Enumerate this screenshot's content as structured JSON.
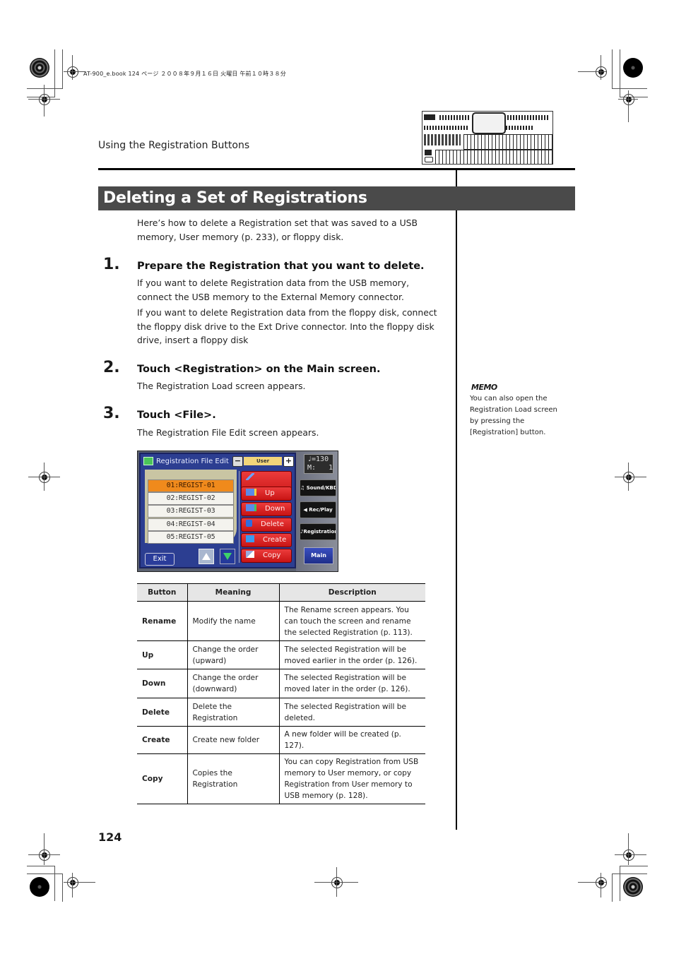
{
  "print_marks": {
    "slug": "AT-900_e.book  124 ページ  ２００８年９月１６日  火曜日  午前１０時３８分"
  },
  "header": {
    "section": "Using the Registration Buttons"
  },
  "page": {
    "title": "Deleting a Set of Registrations",
    "intro": "Here’s how to delete a Registration set that was saved to a USB memory, User memory (p. 233), or floppy disk.",
    "page_number": "124"
  },
  "steps": [
    {
      "number": "1.",
      "title": "Prepare the Registration that you want to delete.",
      "paragraphs": [
        "If you want to delete Registration data from the USB memory, connect the USB memory to the External Memory connector.",
        "If you want to delete Registration data from the floppy disk, connect the floppy disk drive to the Ext Drive connector. Into the floppy disk drive, insert a floppy disk"
      ]
    },
    {
      "number": "2.",
      "title": "Touch <Registration> on the Main screen.",
      "paragraphs": [
        "The Registration Load screen appears."
      ]
    },
    {
      "number": "3.",
      "title": "Touch <File>.",
      "paragraphs": [
        "The Registration File Edit screen appears."
      ]
    }
  ],
  "memo": {
    "label": "MEMO",
    "text": "You can also open the Registration Load screen by pressing the [Registration] button."
  },
  "screen": {
    "title": "Registration File Edit",
    "minus": "−",
    "plus": "+",
    "memory": "User",
    "files": [
      "01:REGIST-01",
      "02:REGIST-02",
      "03:REGIST-03",
      "04:REGIST-04",
      "05:REGIST-05"
    ],
    "selected_index": 0,
    "buttons": [
      "Rename",
      "Up",
      "Down",
      "Delete",
      "Create",
      "Copy"
    ],
    "exit": "Exit",
    "tempo_line1": "♩=130",
    "tempo_line2": "M:   1",
    "side_buttons": [
      "Sound/KBD",
      "Rec/Play",
      "Registration"
    ],
    "main": "Main",
    "colors": {
      "panel": "#2c3e91",
      "selected": "#f08a1c",
      "button": "#d42020"
    }
  },
  "table": {
    "headers": [
      "Button",
      "Meaning",
      "Description"
    ],
    "rows": [
      {
        "button": "Rename",
        "meaning": "Modify the name",
        "description": "The Rename screen appears. You can touch the screen and rename the selected Registration (p. 113)."
      },
      {
        "button": "Up",
        "meaning": "Change the order (upward)",
        "description": "The selected Registration will be moved earlier in the order (p. 126)."
      },
      {
        "button": "Down",
        "meaning": "Change the order (downward)",
        "description": "The selected Registration will be moved later in the order (p. 126)."
      },
      {
        "button": "Delete",
        "meaning": "Delete the Registration",
        "description": "The selected Registration will be deleted."
      },
      {
        "button": "Create",
        "meaning": "Create new folder",
        "description": "A new folder will be created (p. 127)."
      },
      {
        "button": "Copy",
        "meaning": "Copies the Registration",
        "description": "You can copy Registration from USB memory to User memory, or copy Registration from User memory to USB memory (p. 128)."
      }
    ]
  }
}
